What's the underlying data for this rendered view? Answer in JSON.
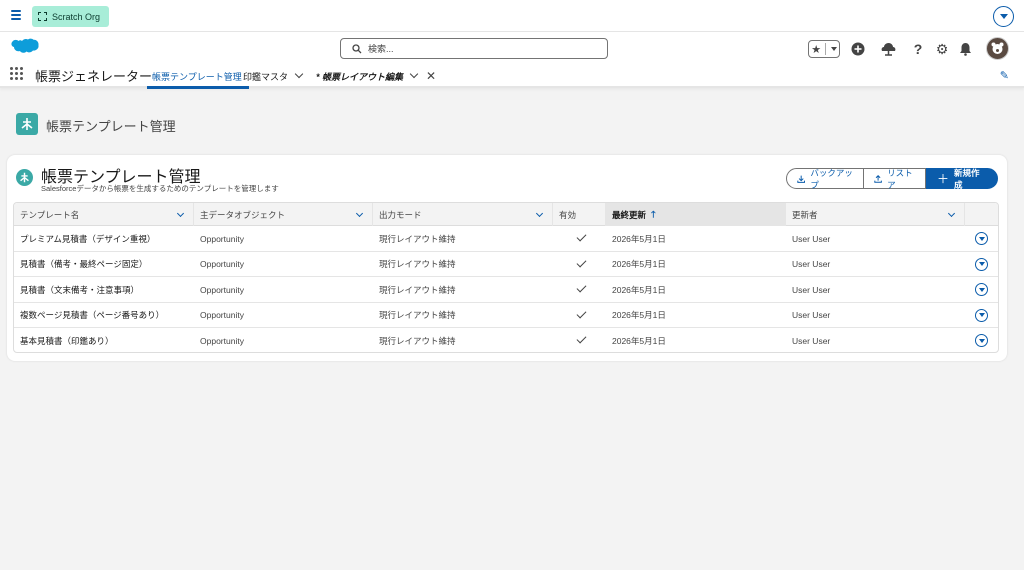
{
  "utility": {
    "org_label": "Scratch Org"
  },
  "header": {
    "search_placeholder": "検索..."
  },
  "nav": {
    "app_name": "帳票ジェネレーター",
    "tabs": [
      {
        "label": "帳票テンプレート管理",
        "active": true
      },
      {
        "label": "印鑑マスタ",
        "has_menu": true
      },
      {
        "label": "* 帳票レイアウト編集",
        "has_menu": true,
        "closable": true
      }
    ]
  },
  "page": {
    "title": "帳票テンプレート管理"
  },
  "card": {
    "title": "帳票テンプレート管理",
    "subtitle": "Salesforceデータから帳票を生成するためのテンプレートを管理します",
    "buttons": {
      "backup": "バックアップ",
      "restore": "リストア",
      "new": "新規作成"
    }
  },
  "table": {
    "columns": [
      "テンプレート名",
      "主データオブジェクト",
      "出力モード",
      "有効",
      "最終更新",
      "更新者"
    ],
    "sorted_column": "最終更新",
    "sort_direction": "ascending",
    "rows": [
      {
        "name": "プレミアム見積書（デザイン重視）",
        "object": "Opportunity",
        "mode": "現行レイアウト維持",
        "active": true,
        "updated": "2026年5月1日",
        "updated_by": "User User"
      },
      {
        "name": "見積書（備考・最終ページ固定）",
        "object": "Opportunity",
        "mode": "現行レイアウト維持",
        "active": true,
        "updated": "2026年5月1日",
        "updated_by": "User User"
      },
      {
        "name": "見積書（文末備考・注意事項）",
        "object": "Opportunity",
        "mode": "現行レイアウト維持",
        "active": true,
        "updated": "2026年5月1日",
        "updated_by": "User User"
      },
      {
        "name": "複数ページ見積書（ページ番号あり）",
        "object": "Opportunity",
        "mode": "現行レイアウト維持",
        "active": true,
        "updated": "2026年5月1日",
        "updated_by": "User User"
      },
      {
        "name": "基本見積書（印鑑あり）",
        "object": "Opportunity",
        "mode": "現行レイアウト維持",
        "active": true,
        "updated": "2026年5月1日",
        "updated_by": "User User"
      }
    ]
  },
  "colors": {
    "brand": "#0b5cab",
    "template_icon": "#3ba9a6",
    "org_badge": "#a8edd8"
  }
}
